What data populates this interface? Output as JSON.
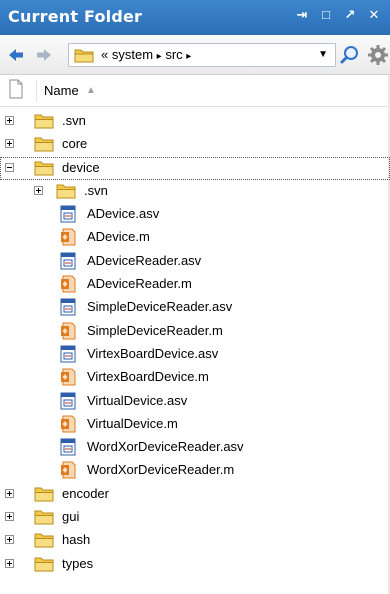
{
  "window": {
    "title": "Current Folder",
    "controls": [
      "undock",
      "maximize",
      "minimize",
      "close"
    ],
    "control_glyphs": {
      "undock": "⇥",
      "maximize": "□",
      "minimize": "↗",
      "close": "✕"
    }
  },
  "toolbar": {
    "breadcrumb_prefix": "«",
    "breadcrumb": [
      "system",
      "src"
    ],
    "separator": "▸",
    "dropdown_glyph": "▼"
  },
  "columns": {
    "name_header": "Name",
    "sort_glyph": "▲"
  },
  "tree": [
    {
      "label": ".svn",
      "kind": "folder",
      "level": 0,
      "expandable": true,
      "expanded": false
    },
    {
      "label": "core",
      "kind": "folder",
      "level": 0,
      "expandable": true,
      "expanded": false
    },
    {
      "label": "device",
      "kind": "folder",
      "level": 0,
      "expandable": true,
      "expanded": true,
      "selected": true
    },
    {
      "label": ".svn",
      "kind": "folder",
      "level": 1,
      "expandable": true,
      "expanded": false
    },
    {
      "label": "ADevice.asv",
      "kind": "asv",
      "level": 1
    },
    {
      "label": "ADevice.m",
      "kind": "mfile",
      "level": 1
    },
    {
      "label": "ADeviceReader.asv",
      "kind": "asv",
      "level": 1
    },
    {
      "label": "ADeviceReader.m",
      "kind": "mfile",
      "level": 1
    },
    {
      "label": "SimpleDeviceReader.asv",
      "kind": "asv",
      "level": 1
    },
    {
      "label": "SimpleDeviceReader.m",
      "kind": "mfile",
      "level": 1
    },
    {
      "label": "VirtexBoardDevice.asv",
      "kind": "asv",
      "level": 1
    },
    {
      "label": "VirtexBoardDevice.m",
      "kind": "mfile",
      "level": 1
    },
    {
      "label": "VirtualDevice.asv",
      "kind": "asv",
      "level": 1
    },
    {
      "label": "VirtualDevice.m",
      "kind": "mfile",
      "level": 1
    },
    {
      "label": "WordXorDeviceReader.asv",
      "kind": "asv",
      "level": 1
    },
    {
      "label": "WordXorDeviceReader.m",
      "kind": "mfile",
      "level": 1
    },
    {
      "label": "encoder",
      "kind": "folder",
      "level": 0,
      "expandable": true,
      "expanded": false
    },
    {
      "label": "gui",
      "kind": "folder",
      "level": 0,
      "expandable": true,
      "expanded": false
    },
    {
      "label": "hash",
      "kind": "folder",
      "level": 0,
      "expandable": true,
      "expanded": false
    },
    {
      "label": "types",
      "kind": "folder",
      "level": 0,
      "expandable": true,
      "expanded": false
    }
  ],
  "colors": {
    "title_bar": "#3d86ce",
    "folder_yellow": "#f2c94c",
    "mfile_orange": "#e07b1e",
    "asv_blue": "#2f5fa8"
  }
}
